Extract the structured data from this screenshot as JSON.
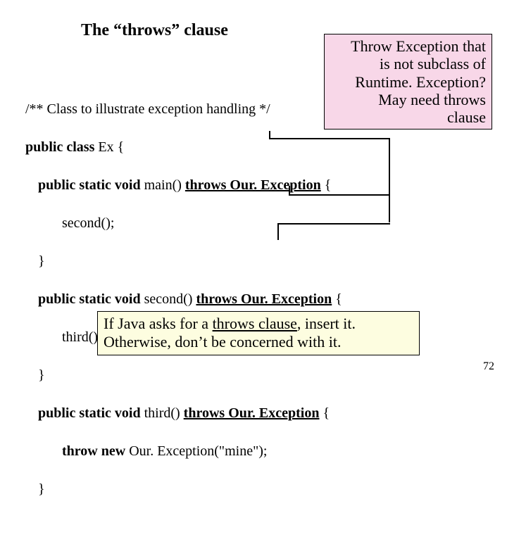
{
  "title": "The “throws” clause",
  "callout": {
    "l1": "Throw Exception that",
    "l2": "is not subclass of",
    "l3": "Runtime. Exception?",
    "l4": "May need throws",
    "l5": "clause"
  },
  "code": {
    "comment": "/** Class to illustrate exception handling */",
    "classdecl_a": "public class",
    "classdecl_b": " Ex {",
    "main_a": "public static void",
    "main_b": " main() ",
    "throws_main": "throws Our. Exception",
    "main_c": " {",
    "main_body": "second();",
    "close1": "}",
    "second_a": "public static void",
    "second_b": " second() ",
    "throws_second": "throws Our. Exception",
    "second_c": " {",
    "second_body": "third();",
    "close2": "}",
    "third_a": "public static void",
    "third_b": " third() ",
    "throws_third": "throws Our. Exception",
    "third_c": " {",
    "third_body_a": "throw new",
    "third_body_b": " Our. Exception(\"mine\");",
    "close3": "}"
  },
  "note": {
    "l1a": "If Java asks for a ",
    "l1u": "throws clause",
    "l1b": ", insert it.",
    "l2": "Otherwise, don’t be concerned with it."
  },
  "pagenum": "72"
}
